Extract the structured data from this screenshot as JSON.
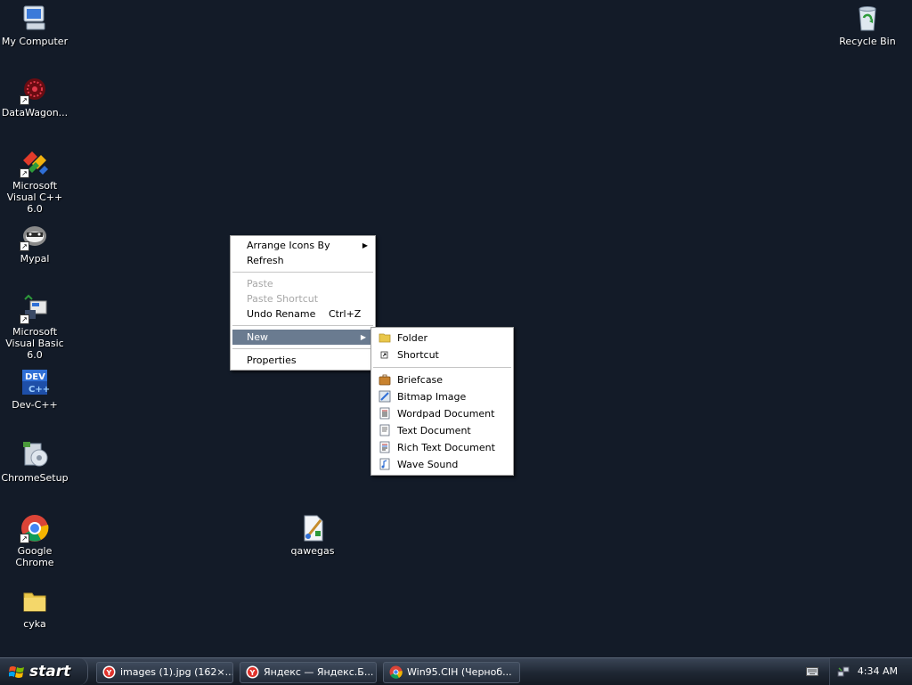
{
  "desktop": {
    "icons": [
      {
        "label": "My Computer",
        "icon": "my-computer-icon"
      },
      {
        "label": "DataWagon...",
        "icon": "datawagon-icon"
      },
      {
        "label": "Microsoft Visual C++ 6.0",
        "icon": "visual-cpp-icon"
      },
      {
        "label": "Mypal",
        "icon": "mypal-icon"
      },
      {
        "label": "Microsoft Visual Basic 6.0",
        "icon": "visual-basic-icon"
      },
      {
        "label": "Dev-C++",
        "icon": "dev-cpp-icon"
      },
      {
        "label": "ChromeSetup",
        "icon": "chrome-setup-icon"
      },
      {
        "label": "Google Chrome",
        "icon": "chrome-icon"
      },
      {
        "label": "cyka",
        "icon": "folder-icon"
      },
      {
        "label": "qawegas",
        "icon": "paint-file-icon"
      },
      {
        "label": "Recycle Bin",
        "icon": "recycle-bin-icon"
      }
    ]
  },
  "context_menu": {
    "items": [
      {
        "label": "Arrange Icons By",
        "submenu": true
      },
      {
        "label": "Refresh"
      },
      {
        "label": "Paste",
        "disabled": true
      },
      {
        "label": "Paste Shortcut",
        "disabled": true
      },
      {
        "label": "Undo Rename",
        "accelerator": "Ctrl+Z"
      },
      {
        "label": "New",
        "submenu": true,
        "selected": true
      },
      {
        "label": "Properties"
      }
    ]
  },
  "new_submenu": {
    "items": [
      {
        "label": "Folder",
        "icon": "folder-icon"
      },
      {
        "label": "Shortcut",
        "icon": "shortcut-icon"
      },
      {
        "label": "Briefcase",
        "icon": "briefcase-icon"
      },
      {
        "label": "Bitmap Image",
        "icon": "bitmap-icon"
      },
      {
        "label": "Wordpad Document",
        "icon": "wordpad-icon"
      },
      {
        "label": "Text Document",
        "icon": "text-document-icon"
      },
      {
        "label": "Rich Text Document",
        "icon": "rich-text-icon"
      },
      {
        "label": "Wave Sound",
        "icon": "wave-sound-icon"
      }
    ]
  },
  "taskbar": {
    "start_label": "start",
    "tasks": [
      {
        "label": "images (1).jpg (162×...",
        "icon": "yandex-browser-icon"
      },
      {
        "label": "Яндекс — Яндекс.Б...",
        "icon": "yandex-browser-icon"
      },
      {
        "label": "Win95.CIH (Черноб...",
        "icon": "chrome-icon"
      }
    ],
    "clock": "4:34 AM"
  },
  "colors": {
    "desktop_bg": "#131b28",
    "menu_highlight": "#6a7b90"
  }
}
